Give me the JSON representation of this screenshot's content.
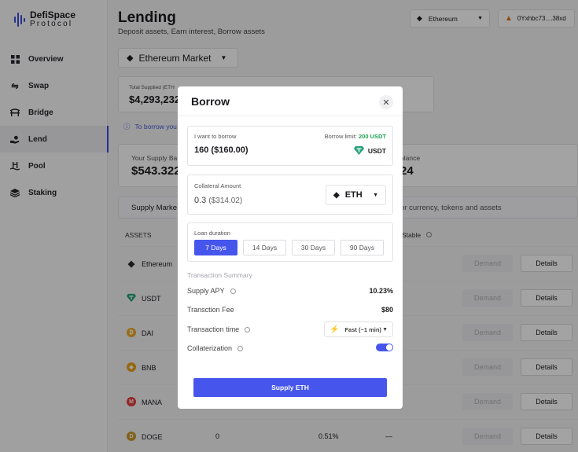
{
  "brand": {
    "line1": "DefiSpace",
    "line2": "Protocol"
  },
  "sidebar": {
    "items": [
      {
        "label": "Overview",
        "icon": "grid-icon"
      },
      {
        "label": "Swap",
        "icon": "swap-icon"
      },
      {
        "label": "Bridge",
        "icon": "bridge-icon"
      },
      {
        "label": "Lend",
        "icon": "lend-icon",
        "active": true
      },
      {
        "label": "Pool",
        "icon": "pool-icon"
      },
      {
        "label": "Staking",
        "icon": "staking-icon"
      }
    ]
  },
  "header": {
    "title": "Lending",
    "subtitle": "Deposit assets, Earn interest, Borrow assets",
    "network": "Ethereum",
    "wallet": "0Yxhbc73....38xd",
    "market": "Ethereum Market"
  },
  "stats": {
    "total_supplied_label": "Total Supplied (ETH",
    "total_supplied_value": "$4,293,232"
  },
  "info_text": "To borrow you",
  "supply_card": {
    "supply_balance_label": "Your Supply Ba",
    "supply_balance_value": "$543.322",
    "right_label": "alance",
    "right_value": "24"
  },
  "tabs": {
    "supply_market": "Supply Marke",
    "search_text": "or currency, tokens and assets"
  },
  "table": {
    "headers": {
      "assets": "ASSETS",
      "stable": "Stable"
    },
    "demand_label": "Demand",
    "details_label": "Details",
    "rows": [
      {
        "name": "Ethereum",
        "icon": "ethereum-icon",
        "color": "#2b2b2b",
        "symbol": "",
        "col1": "",
        "col2": "",
        "col3": ""
      },
      {
        "name": "USDT",
        "icon": "tether-icon",
        "color": "#26a17b",
        "symbol": "",
        "col1": "",
        "col2": "",
        "col3": ""
      },
      {
        "name": "DAI",
        "icon": "dai-icon",
        "color": "#f0a821",
        "symbol": "₿",
        "col1": "",
        "col2": "",
        "col3": ""
      },
      {
        "name": "BNB",
        "icon": "bnb-icon",
        "color": "#e8a317",
        "symbol": "◆",
        "col1": "",
        "col2": "",
        "col3": ""
      },
      {
        "name": "MANA",
        "icon": "mana-icon",
        "color": "#e63c3c",
        "symbol": "M",
        "col1": "",
        "col2": "",
        "col3": ""
      },
      {
        "name": "DOGE",
        "icon": "doge-icon",
        "color": "#c99a2e",
        "symbol": "D",
        "col1": "0",
        "col2": "0.51%",
        "col3": "—"
      }
    ]
  },
  "modal": {
    "title": "Borrow",
    "want_label": "I want to borrow",
    "borrow_limit_label": "Borrow limit:",
    "borrow_limit_value": "200 USDT",
    "borrow_amount": "160",
    "borrow_fiat": "($160.00)",
    "borrow_token": "USDT",
    "collateral_label": "Collateral Amount",
    "collateral_amount": "0.3",
    "collateral_fiat": "($314.02)",
    "collateral_token": "ETH",
    "duration_label": "Loan duration",
    "durations": [
      "7 Days",
      "14 Days",
      "30 Days",
      "90 Days"
    ],
    "selected_duration": "7 Days",
    "summary_title": "Transaction Summary",
    "supply_apy_label": "Supply APY",
    "supply_apy_value": "10.23%",
    "fee_label": "Transction Fee",
    "fee_value": "$80",
    "time_label": "Transaction time",
    "time_value": "Fast (~1 min)",
    "collat_label": "Collaterization",
    "collat_enabled": true,
    "submit_label": "Supply ETH"
  },
  "colors": {
    "accent": "#4656ec",
    "limit_green": "#1fa451"
  }
}
